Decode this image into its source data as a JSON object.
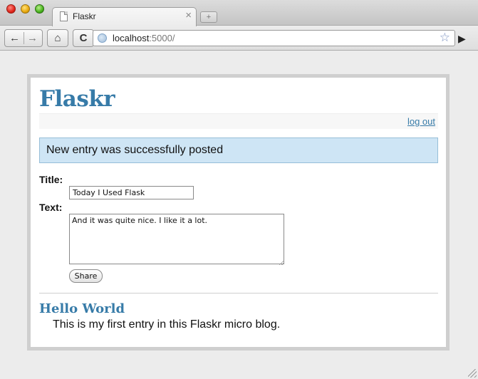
{
  "browser": {
    "tab_title": "Flaskr",
    "tab_close": "×",
    "new_tab": "+",
    "back": "←",
    "forward": "→",
    "home": "⌂",
    "reload": "C",
    "url_host": "localhost",
    "url_port": ":5000/",
    "bookmark": "☆",
    "go": "▶"
  },
  "page": {
    "site_title": "Flaskr",
    "logout": "log out",
    "flash_message": "New entry was successfully posted",
    "title_label": "Title:",
    "title_value": "Today I Used Flask",
    "text_label": "Text:",
    "text_value": "And it was quite nice. I like it a lot.",
    "share_label": "Share",
    "entries": [
      {
        "title": "Hello World",
        "body": "This is my first entry in this Flaskr micro blog."
      }
    ]
  },
  "colors": {
    "accent": "#377ba8",
    "flash_bg": "#cee5f5",
    "page_bg": "#ececec"
  }
}
